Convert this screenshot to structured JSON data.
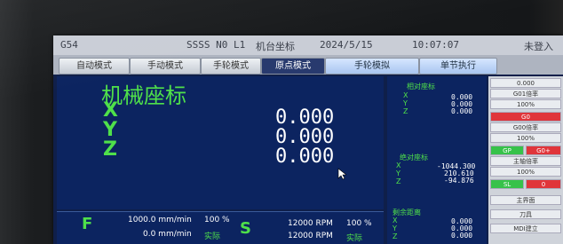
{
  "topbar": {
    "coord_sys": "G54",
    "status": "SSSS N0 L1",
    "panel": "机台坐标",
    "date": "2024/5/15",
    "time": "10:07:07",
    "alarm": "未登入"
  },
  "tabs": [
    "自动模式",
    "手动模式",
    "手轮模式",
    "原点模式",
    "手轮模拟",
    "单节执行"
  ],
  "active_tab": "原点模式",
  "main": {
    "title": "机械座标",
    "axes": [
      {
        "label": "X",
        "value": "0.000"
      },
      {
        "label": "Y",
        "value": "0.000"
      },
      {
        "label": "Z",
        "value": "0.000"
      }
    ]
  },
  "right_panel": {
    "relative": {
      "title": "相对座标",
      "axes": [
        "X",
        "Y",
        "Z"
      ],
      "values": [
        "0.000",
        "0.000",
        "0.000"
      ]
    },
    "absolute": {
      "title": "绝对座标",
      "axes": [
        "X",
        "Y",
        "Z"
      ],
      "values": [
        "-1044.300",
        "210.610",
        "-94.876"
      ]
    },
    "remaining": {
      "title": "剩余距离",
      "axes": [
        "X",
        "Y",
        "Z"
      ],
      "values": [
        "0.000",
        "0.000",
        "0.000"
      ]
    }
  },
  "side_panel": {
    "items": [
      "0.000",
      "G01倍率",
      "100%",
      "G0",
      "G00倍率",
      "100%",
      "GP",
      "G0+",
      "主轴倍率",
      "100%",
      "SL",
      "0",
      "主界面",
      "刀具",
      "MDI建立"
    ]
  },
  "bottom": {
    "f_label": "F",
    "f_value": "1000.0 mm/min",
    "f_pct": "100 %",
    "f_actual_value": "0.0 mm/min",
    "f_actual_label": "实际",
    "s_label": "S",
    "s_value": "12000 RPM",
    "s_pct": "100 %",
    "s_actual_value": "12000 RPM",
    "s_actual_label": "实际"
  },
  "colors": {
    "screen_bg": "#0c2460",
    "green_text": "#4fe04a",
    "active_tab": "#283a6e",
    "warn_red": "#e0353a",
    "ok_green": "#37c24a"
  }
}
